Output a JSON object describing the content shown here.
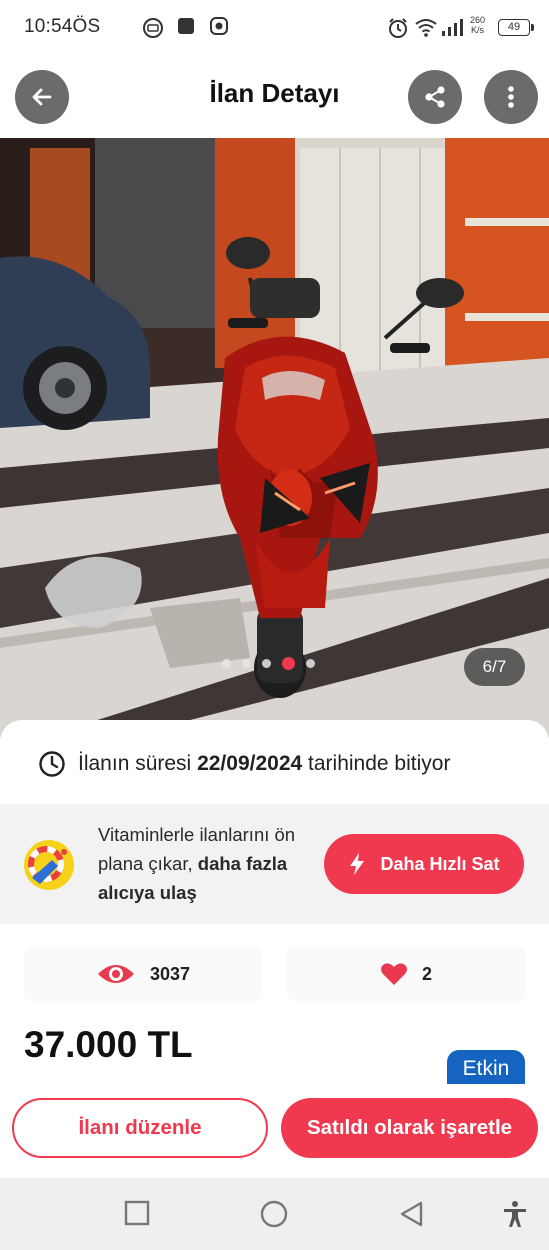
{
  "status_bar": {
    "time": "10:54ÖS",
    "net_speed_value": "260",
    "net_speed_unit": "K/s",
    "battery": "49",
    "icons": [
      "gallery-icon",
      "square-app-icon",
      "instagram-icon",
      "alarm-icon",
      "wifi-icon",
      "signal-icon",
      "battery-icon"
    ]
  },
  "header": {
    "title": "İlan Detayı",
    "icons": [
      "back-arrow-icon",
      "share-icon",
      "more-vert-icon"
    ]
  },
  "gallery": {
    "counter": "6/7",
    "current_index": 4,
    "dot_count": 5
  },
  "expiry": {
    "prefix": "İlanın süresi",
    "date": "22/09/2024",
    "suffix": "tarihinde bitiyor"
  },
  "promo": {
    "text_part1": "Vitaminlerle ilanlarını ön plana çıkar,",
    "text_bold": "daha fazla alıcıya ulaş",
    "button_label": "Daha Hızlı Sat"
  },
  "stats": {
    "views": "3037",
    "favorites": "2"
  },
  "price": "37.000 TL",
  "status_badge": "Etkin",
  "actions": {
    "edit_label": "İlanı düzenle",
    "mark_sold_label": "Satıldı olarak işaretle"
  },
  "colors": {
    "accent": "#f0394f",
    "badge_blue": "#1564c0",
    "header_button": "#6b6b6b"
  }
}
